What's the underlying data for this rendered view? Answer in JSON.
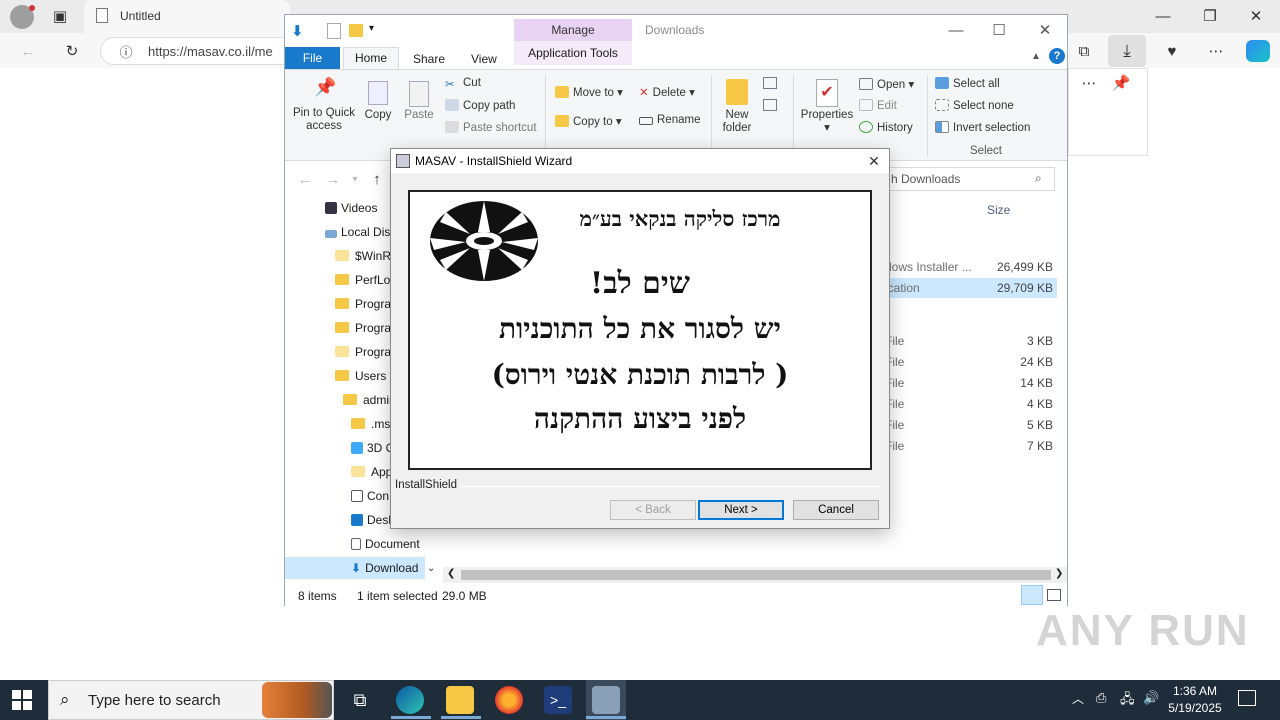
{
  "browser": {
    "tab_title": "Untitled",
    "url": "https://masav.co.il/me"
  },
  "explorer": {
    "manage_tab": "Manage",
    "app_tools_tab": "Application Tools",
    "window_title": "Downloads",
    "tabs": {
      "file": "File",
      "home": "Home",
      "share": "Share",
      "view": "View"
    },
    "ribbon": {
      "pin": "Pin to Quick access",
      "copy": "Copy",
      "paste": "Paste",
      "cut": "Cut",
      "copy_path": "Copy path",
      "paste_shortcut": "Paste shortcut",
      "move_to": "Move to",
      "copy_to": "Copy to",
      "delete": "Delete",
      "rename": "Rename",
      "new_folder": "New folder",
      "properties": "Properties",
      "open": "Open",
      "edit": "Edit",
      "history": "History",
      "select_all": "Select all",
      "select_none": "Select none",
      "invert_selection": "Invert selection",
      "select_group": "Select"
    },
    "search_placeholder": "h Downloads",
    "size_header": "Size",
    "tree": [
      {
        "label": "Videos"
      },
      {
        "label": "Local Dis"
      },
      {
        "label": "$WinRE"
      },
      {
        "label": "PerfLog"
      },
      {
        "label": "Progra"
      },
      {
        "label": "Progra"
      },
      {
        "label": "Progra"
      },
      {
        "label": "Users"
      },
      {
        "label": "admin"
      },
      {
        "label": ".ms-"
      },
      {
        "label": "3D C"
      },
      {
        "label": "App"
      },
      {
        "label": "Con"
      },
      {
        "label": "Desk"
      },
      {
        "label": "Document"
      },
      {
        "label": "Download"
      }
    ],
    "rows": [
      {
        "type": "dows Installer ...",
        "size": "26,499 KB",
        "selected": false
      },
      {
        "type": "ication",
        "size": "29,709 KB",
        "selected": true
      },
      {
        "type": "File",
        "size": "3 KB",
        "selected": false
      },
      {
        "type": "File",
        "size": "24 KB",
        "selected": false
      },
      {
        "type": "File",
        "size": "14 KB",
        "selected": false
      },
      {
        "type": "File",
        "size": "4 KB",
        "selected": false
      },
      {
        "type": "File",
        "size": "5 KB",
        "selected": false
      },
      {
        "type": "File",
        "size": "7 KB",
        "selected": false
      }
    ],
    "status": {
      "items": "8 items",
      "selected": "1 item selected",
      "size": "29.0 MB"
    }
  },
  "dialog": {
    "title": "MASAV - InstallShield Wizard",
    "banner": {
      "org": "מרכז סליקה בנקאי בע״מ",
      "line1": "שים לב!",
      "line2": "יש לסגור את כל התוכניות",
      "line3": "( לרבות תוכנת אנטי וירוס)",
      "line4": "לפני ביצוע ההתקנה"
    },
    "installshield_label": "InstallShield",
    "back": "< Back",
    "next": "Next >",
    "cancel": "Cancel"
  },
  "taskbar": {
    "search_placeholder": "Type here to search",
    "time": "1:36 AM",
    "date": "5/19/2025"
  },
  "watermark": "ANY RUN"
}
